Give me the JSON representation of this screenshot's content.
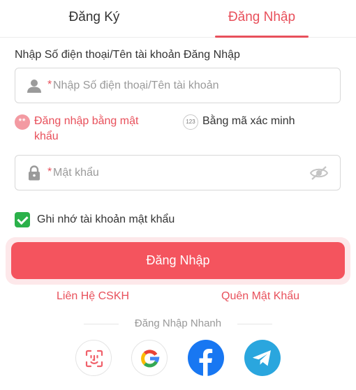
{
  "tabs": {
    "register": "Đăng Ký",
    "login": "Đăng Nhập"
  },
  "form": {
    "account_label": "Nhập Số điện thoại/Tên tài khoản Đăng Nhập",
    "required_mark": "*",
    "account_placeholder": "Nhập Số điện thoại/Tên tài khoản",
    "account_value": "",
    "password_placeholder": "Mật khẩu",
    "password_value": ""
  },
  "login_modes": {
    "password": "Đăng nhập bằng mật khẩu",
    "otp": "Bằng mã xác minh",
    "selected": "password"
  },
  "remember": {
    "label": "Ghi nhớ tài khoản mật khẩu",
    "checked": true
  },
  "submit_label": "Đăng Nhập",
  "links": {
    "support": "Liên Hệ CSKH",
    "forgot": "Quên Mật Khẩu"
  },
  "quick_login": {
    "title": "Đăng Nhập Nhanh",
    "providers": [
      "face-id-icon",
      "google-icon",
      "facebook-icon",
      "telegram-icon"
    ]
  },
  "colors": {
    "accent": "#e8505b",
    "button": "#f4545e",
    "check": "#2bb14a",
    "facebook": "#1877f2",
    "telegram": "#2aa6de"
  }
}
